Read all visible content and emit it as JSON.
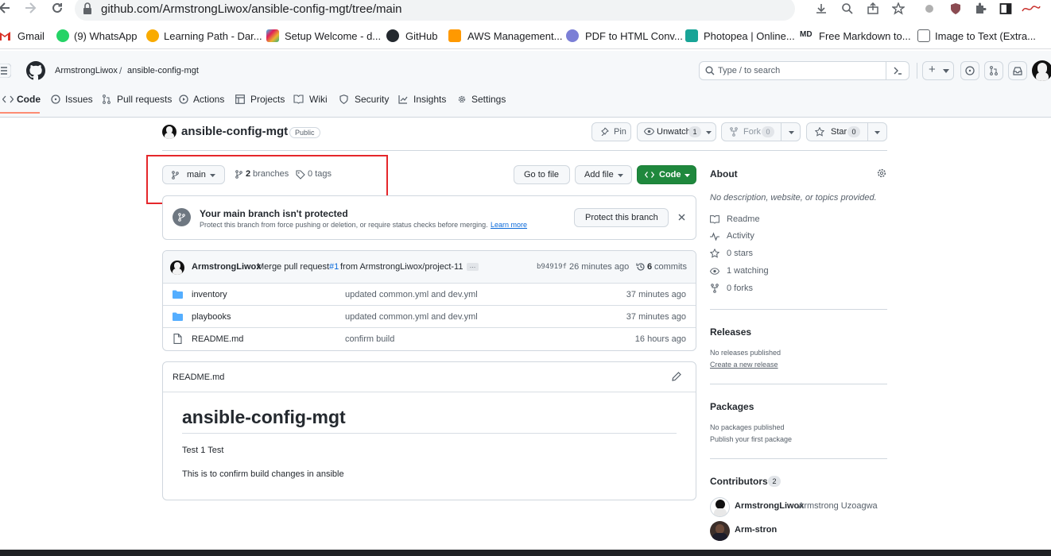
{
  "browser": {
    "url": "github.com/ArmstrongLiwox/ansible-config-mgt/tree/main",
    "bookmarks": [
      "Gmail",
      "(9) WhatsApp",
      "Learning Path - Dar...",
      "Setup Welcome - d...",
      "GitHub",
      "AWS Management...",
      "PDF to HTML Conv...",
      "Photopea | Online...",
      "Free Markdown to...",
      "Image to Text (Extra..."
    ]
  },
  "header": {
    "owner": "ArmstrongLiwox",
    "repo": "ansible-config-mgt",
    "search_placeholder": "Type / to search",
    "plus": "+"
  },
  "tabs": [
    "Code",
    "Issues",
    "Pull requests",
    "Actions",
    "Projects",
    "Wiki",
    "Security",
    "Insights",
    "Settings"
  ],
  "repo_header": {
    "title": "ansible-config-mgt",
    "visibility": "Public",
    "pin": "Pin",
    "unwatch": "Unwatch",
    "unwatch_count": "1",
    "fork": "Fork",
    "fork_count": "0",
    "star": "Star",
    "star_count": "0"
  },
  "toolbar": {
    "branch": "main",
    "branches_count": "2",
    "branches_label": "branches",
    "tags": "0 tags",
    "go_to_file": "Go to file",
    "add_file": "Add file",
    "code": "Code"
  },
  "protect": {
    "title": "Your main branch isn't protected",
    "desc": "Protect this branch from force pushing or deletion, or require status checks before merging.",
    "learn": "Learn more",
    "button": "Protect this branch"
  },
  "commit": {
    "author": "ArmstrongLiwox",
    "message_pre": "Merge pull request",
    "pr": "#1",
    "message_post": "from ArmstrongLiwox/project-11",
    "ellipsis": "…",
    "hash": "b94919f",
    "time": "26 minutes ago",
    "commits_count": "6",
    "commits_label": "commits"
  },
  "files": [
    {
      "name": "inventory",
      "message": "updated common.yml and dev.yml",
      "time": "37 minutes ago",
      "type": "folder"
    },
    {
      "name": "playbooks",
      "message": "updated common.yml and dev.yml",
      "time": "37 minutes ago",
      "type": "folder"
    },
    {
      "name": "README.md",
      "message": "confirm build",
      "time": "16 hours ago",
      "type": "file"
    }
  ],
  "readme": {
    "filename": "README.md",
    "heading": "ansible-config-mgt",
    "p1": "Test 1 Test",
    "p2": "This is to confirm build changes in ansible"
  },
  "about": {
    "title": "About",
    "desc": "No description, website, or topics provided.",
    "readme": "Readme",
    "activity": "Activity",
    "stars": "0 stars",
    "watching": "1 watching",
    "forks": "0 forks"
  },
  "releases": {
    "title": "Releases",
    "none": "No releases published",
    "create": "Create a new release"
  },
  "packages": {
    "title": "Packages",
    "none": "No packages published",
    "publish": "Publish your first package"
  },
  "contributors": {
    "title": "Contributors",
    "count": "2",
    "list": [
      {
        "login": "ArmstrongLiwox",
        "name": "Armstrong Uzoagwa"
      },
      {
        "login": "Arm-stron",
        "name": ""
      }
    ]
  },
  "colors": {
    "accent": "#0969da",
    "green": "#1f883d",
    "highlight": "#e5272b",
    "tab_underline": "#fd8c73"
  }
}
